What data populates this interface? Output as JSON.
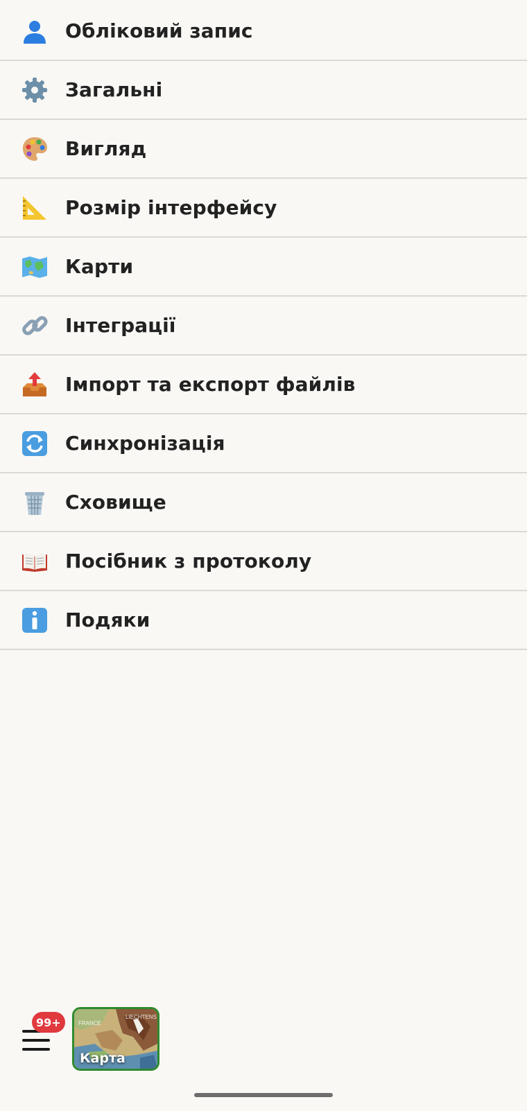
{
  "menu": {
    "items": [
      {
        "label": "Обліковий запис",
        "icon": "account-icon"
      },
      {
        "label": "Загальні",
        "icon": "gear-icon"
      },
      {
        "label": "Вигляд",
        "icon": "palette-icon"
      },
      {
        "label": "Розмір інтерфейсу",
        "icon": "triangle-ruler-icon"
      },
      {
        "label": "Карти",
        "icon": "world-map-icon"
      },
      {
        "label": "Інтеграції",
        "icon": "link-icon"
      },
      {
        "label": "Імпорт та експорт файлів",
        "icon": "outbox-tray-icon"
      },
      {
        "label": "Синхронізація",
        "icon": "sync-arrows-icon"
      },
      {
        "label": "Сховище",
        "icon": "trash-bin-icon"
      },
      {
        "label": "Посібник з протоколу",
        "icon": "open-book-icon"
      },
      {
        "label": "Подяки",
        "icon": "info-icon"
      }
    ]
  },
  "bottom_bar": {
    "badge": "99+",
    "map_tile_label": "Карта",
    "map_labels": [
      "FRANCE",
      "LIECHTENS"
    ]
  },
  "colors": {
    "background": "#f9f8f5",
    "divider": "#d9d9d6",
    "text": "#222222",
    "badge": "#e0393e",
    "map_tile_border": "#2f8a2f"
  }
}
